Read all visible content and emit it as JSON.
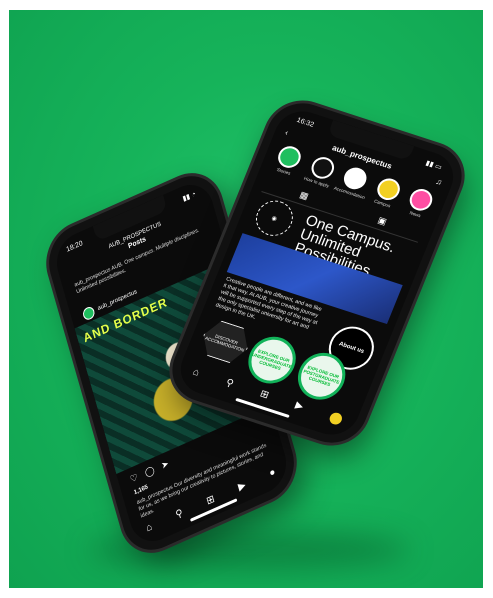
{
  "back_phone": {
    "time": "18:20",
    "header_account": "AUB_PROSPECTUS",
    "header_title": "Posts",
    "caption_top": "aub_prospectus AUB. One campus. Multiple disciplines. Unlimited possibilities.",
    "username": "aub_prospectus",
    "post_banner": "AND BORDER",
    "likes": "1,165",
    "caption": "aub_prospectus Our diversity and meaningful work stands for us, as we bring our creativity to pictures, stories, and ideas.",
    "nav_icons": [
      "home-icon",
      "search-icon",
      "add-icon",
      "reels-icon",
      "profile-icon"
    ]
  },
  "front_phone": {
    "time": "16:32",
    "username": "aub_prospectus",
    "highlights": [
      {
        "label": "Stories",
        "color": "#1fbf5f"
      },
      {
        "label": "How to apply",
        "color": "#111111"
      },
      {
        "label": "Accommodation",
        "color": "#ffffff"
      },
      {
        "label": "Campus",
        "color": "#f2d023"
      },
      {
        "label": "News",
        "color": "#ff4fa3"
      }
    ],
    "hero_text": "One Campus. Unlimited Possibilities.",
    "body_text": "Creative people are different, and we like it that way. At AUB, your creative journey will be supported every step of the way at the only specialist university for art and design in the UK.",
    "about_badge": "About us",
    "hex_label": "DISCOVER ACCOMMODATION",
    "explore_1": "EXPLORE OUR UNDERGRADUATE COURSES",
    "explore_2": "EXPLORE OUR POSTGRADUATE COURSES"
  }
}
